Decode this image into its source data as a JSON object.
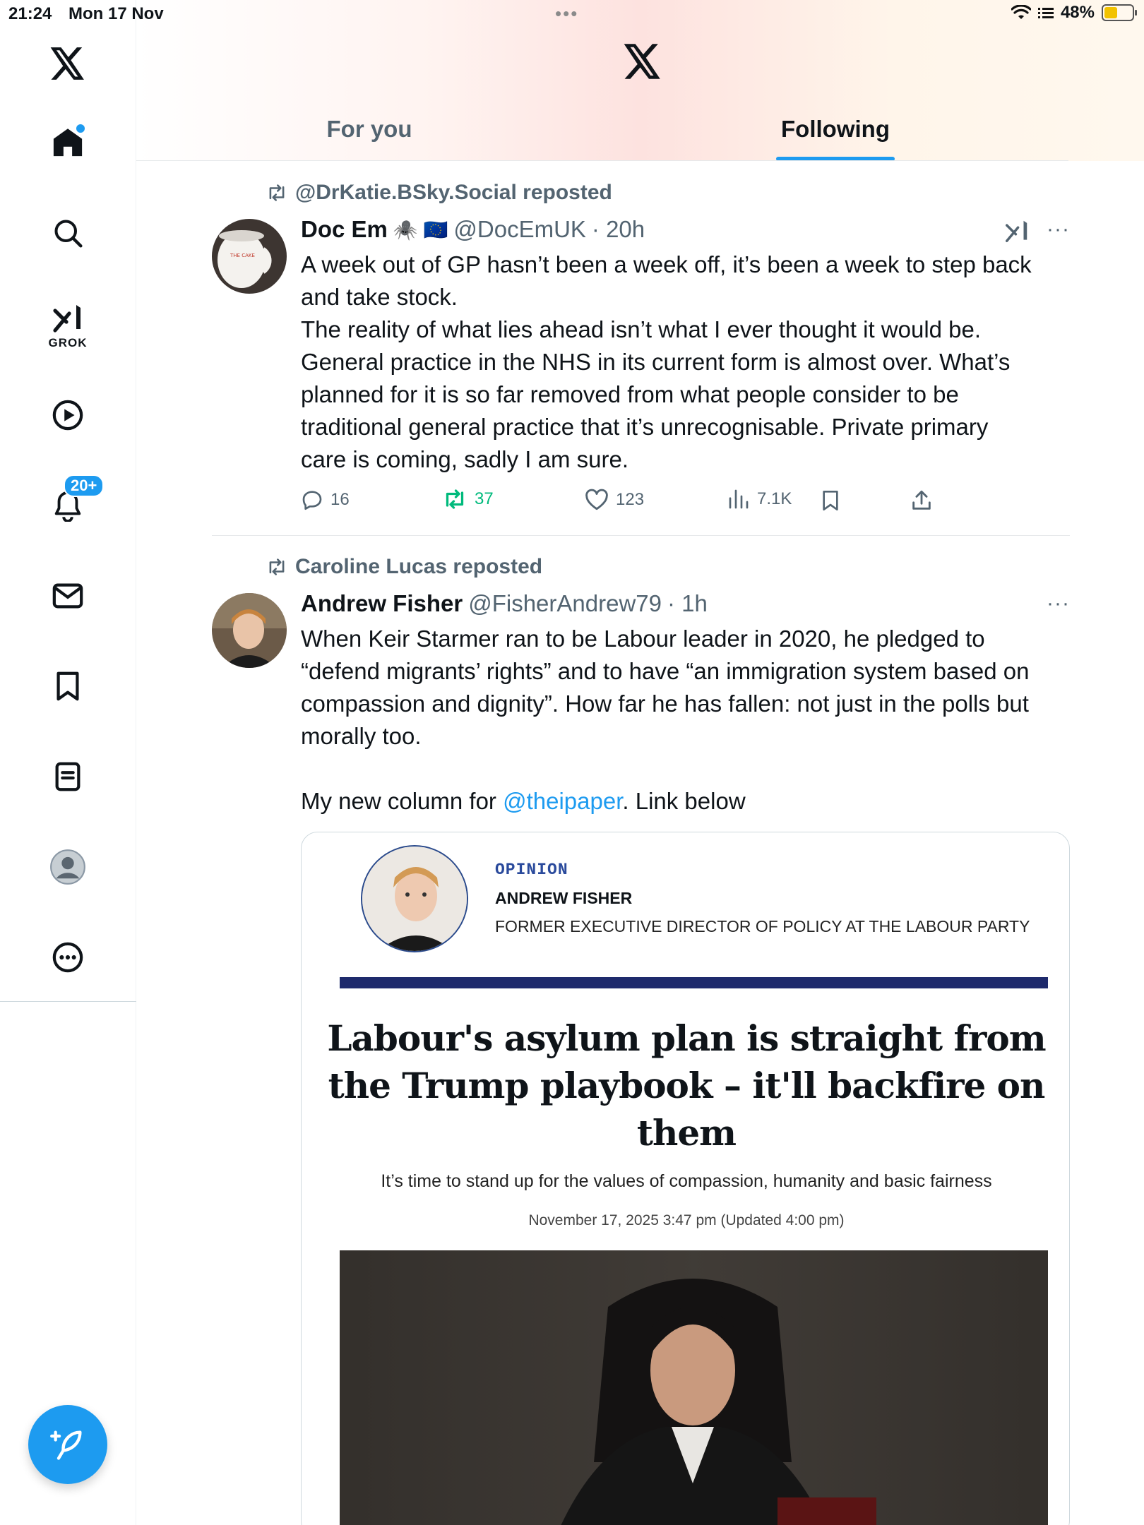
{
  "status_bar": {
    "time": "21:24",
    "date": "Mon 17 Nov",
    "battery": "48%",
    "battery_level": 0.48
  },
  "header": {
    "tabs": [
      {
        "label": "For you",
        "active": false
      },
      {
        "label": "Following",
        "active": true
      }
    ]
  },
  "sidebar": {
    "grok_label": "GROK",
    "notifications_badge": "20+",
    "items": [
      "x-logo",
      "home-icon",
      "search-icon",
      "grok-icon",
      "video-icon",
      "bell-icon",
      "mail-icon",
      "bookmark-icon",
      "lists-icon",
      "profile-icon",
      "more-icon"
    ]
  },
  "tweets": [
    {
      "repost_by": "@DrKatie.BSky.Social reposted",
      "name": "Doc Em",
      "emoji": "🕷️ 🇪🇺",
      "handle": "@DocEmUK",
      "time": "· 20h",
      "text_lines": [
        "A week out of GP hasn’t been a week off, it’s been a week to step back",
        "and take stock.",
        "The reality of what lies ahead isn’t what I ever thought it would be.",
        "General practice in the NHS in its current form is almost over. What’s",
        "planned for it is so far removed from what people consider to be",
        "traditional general practice that it’s unrecognisable. Private primary",
        "care is coming, sadly I am sure."
      ],
      "replies": "16",
      "reposts": "37",
      "likes": "123",
      "views": "7.1K",
      "more": "···"
    },
    {
      "repost_by": "Caroline Lucas reposted",
      "name": "Andrew Fisher",
      "handle": "@FisherAndrew79",
      "time": "· 1h",
      "text_lines": [
        "When Keir Starmer ran to be Labour leader in 2020, he pledged to",
        "“defend migrants’ rights” and to have “an immigration system based on",
        "compassion and dignity”. How far he has fallen: not just in the polls but",
        "morally too."
      ],
      "text_prefix": "My new column for ",
      "text_link": "@theipaper",
      "text_suffix": ". Link below",
      "more": "···",
      "card": {
        "section": "OPINION",
        "author": "ANDREW FISHER",
        "role": "FORMER EXECUTIVE DIRECTOR OF POLICY AT THE LABOUR PARTY",
        "headline_lines": [
          "Labour's asylum plan is straight from",
          "the Trump playbook – it'll backfire on",
          "them"
        ],
        "standfirst": "It’s time to stand up for the values of compassion, humanity and basic fairness",
        "dateline": "November 17, 2025 3:47 pm (Updated 4:00 pm)",
        "mug_text": "THE CAKE"
      }
    }
  ],
  "colors": {
    "accent": "#1d9bf0",
    "repost_green": "#00ba7c",
    "secondary_text": "#536471",
    "card_bar": "#1e2a6c"
  }
}
